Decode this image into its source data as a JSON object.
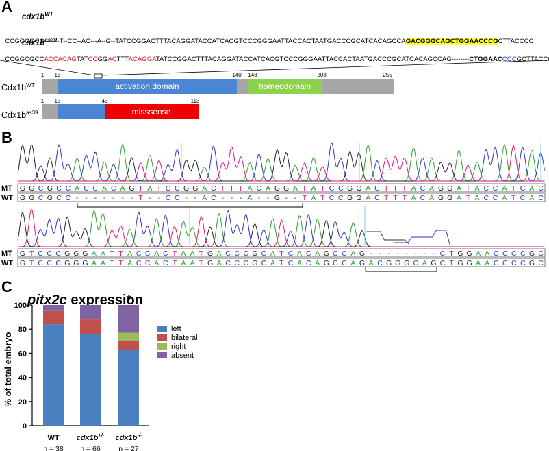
{
  "panels": {
    "a": "A",
    "b": "B",
    "c": "C"
  },
  "panel_a": {
    "wt_name": {
      "base": "cdx1b",
      "sup": "WT"
    },
    "mut_name": {
      "base": "cdx1b",
      "sup": "as39"
    },
    "wt_seq": {
      "pre": "CCGGCGCC-------T--CC--AC---A--G--TATCCGGACTTTACAGGATACCATCACGTCCCGGGAATTACCACTAATGACCCGCATCACAGCCA",
      "hl": "GACGGGCAGCTGGAACCCG",
      "post": "CTTACCCC"
    },
    "mut_seq": {
      "s1": "CCGGCGCC",
      "s2": "ACCACAG",
      "s3": "TAT",
      "s4": "CC",
      "s5": "GG",
      "s6": "AC",
      "s7": "TTT",
      "s8": "A",
      "s9": "CAGGA",
      "s10": "TATCCGGACTTTACAGGATACCATCACGTCCCGGGAATTACCACTAATGACCCGCATCACAGCCAG--------",
      "s11": "CTGGAAC",
      "s12": "CCC",
      "s13": "GCTTACCCC"
    },
    "protein_wt": {
      "name": "Cdx1b",
      "sup": "WT",
      "domains": [
        "activation domain",
        "homeodomain"
      ],
      "ticks": [
        "1",
        "13",
        "140",
        "148",
        "203",
        "255"
      ]
    },
    "protein_mut": {
      "name": "Cdx1b",
      "sup": "as39",
      "domains": [
        "misssense"
      ],
      "ticks": [
        "1",
        "13",
        "43",
        "113"
      ]
    }
  },
  "panel_b": {
    "row1": {
      "mt_label": "MT",
      "wt_label": "WT",
      "mt_seq": "GGCGCCACCACAGTATCCGGACTTTACAGGATATCCGGACTTTACAGGATACCATCAC",
      "wt_seq": "GGCGCC-------T--CC--AC---A--G--TATCCGGACTTTACAGGATACCATCAC"
    },
    "row2": {
      "mt_label": "MT",
      "wt_label": "WT",
      "mt_seq": "GTCCCGGGAATTACCACTAATGACCCGCATCACAGCCAG--------CTGGAACCCCGC",
      "wt_seq": "GTCCCGGGAATTACCACTAATGACCCGCATCACAGCCAGACGGGCAGCTGGAACCCCGC"
    }
  },
  "chart_data": {
    "type": "bar",
    "stacked": true,
    "title": {
      "gene": "pitx2c",
      "rest": " expression"
    },
    "ylabel": "% of total embryo",
    "ylim": [
      0,
      100
    ],
    "yticks": [
      0,
      20,
      40,
      60,
      80,
      100
    ],
    "categories": [
      {
        "base": "WT",
        "sup": "",
        "n": "n = 38"
      },
      {
        "base": "cdx1b",
        "sup": "+/-",
        "n": "n = 66"
      },
      {
        "base": "cdx1b",
        "sup": "-/-",
        "n": "n = 27"
      }
    ],
    "series": [
      {
        "name": "left",
        "color": "#4a7fc0",
        "values": [
          84,
          76,
          63
        ]
      },
      {
        "name": "bilateral",
        "color": "#c0504d",
        "values": [
          11,
          12,
          7
        ]
      },
      {
        "name": "right",
        "color": "#9bbb59",
        "values": [
          0,
          0,
          7
        ]
      },
      {
        "name": "absent",
        "color": "#8064a2",
        "values": [
          5,
          12,
          23
        ]
      }
    ],
    "annotation": "*",
    "legend_position": "right"
  }
}
